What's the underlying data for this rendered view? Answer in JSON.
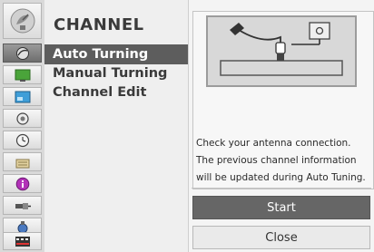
{
  "menu": {
    "title": "CHANNEL",
    "items": [
      {
        "label": "Auto Turning",
        "selected": true
      },
      {
        "label": "Manual Turning",
        "selected": false
      },
      {
        "label": "Channel Edit",
        "selected": false
      }
    ]
  },
  "sidebar": {
    "icons": [
      "satellite-dish-icon",
      "channel-icon",
      "picture-icon",
      "screen-icon",
      "audio-icon",
      "clock-icon",
      "lock-icon",
      "info-icon",
      "input-plug-icon",
      "usb-icon",
      "media-icon"
    ]
  },
  "info": {
    "lines": [
      "Check your antenna connection.",
      "The previous channel information",
      "will be updated during Auto Tuning."
    ]
  },
  "buttons": {
    "start_label": "Start",
    "close_label": "Close"
  },
  "colors": {
    "selected_bg": "#5d5d5d",
    "start_bg": "#666666"
  }
}
